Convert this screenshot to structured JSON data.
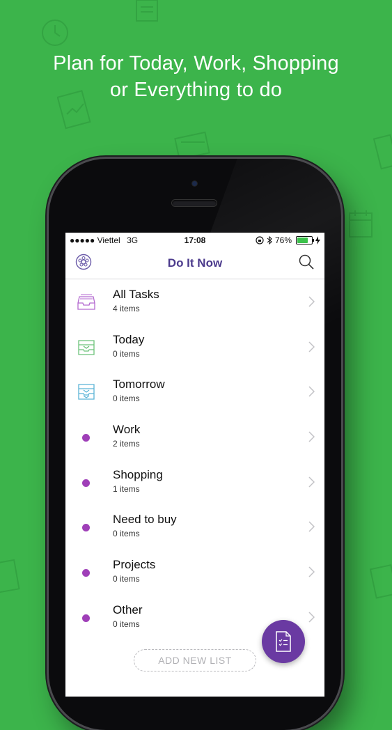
{
  "headline": {
    "line1": "Plan for Today, Work, Shopping",
    "line2": "or Everything to do"
  },
  "statusbar": {
    "carrier": "●●●●● Viettel",
    "network": "3G",
    "time": "17:08",
    "battery_pct": "76%",
    "battery_level": 0.76
  },
  "navbar": {
    "title": "Do It Now",
    "left_icon": "wheel-icon",
    "right_icon": "search-icon"
  },
  "lists": [
    {
      "name": "All Tasks",
      "count": "4 items",
      "icon": "inbox-tray-icon",
      "color": "#b46ad0"
    },
    {
      "name": "Today",
      "count": "0 items",
      "icon": "today-tray-icon",
      "color": "#6cc27a"
    },
    {
      "name": "Tomorrow",
      "count": "0 items",
      "icon": "tomorrow-tray-icon",
      "color": "#5ab3d6"
    },
    {
      "name": "Work",
      "count": "2 items",
      "icon": "dot",
      "color": "#9f3fb8"
    },
    {
      "name": "Shopping",
      "count": "1 items",
      "icon": "dot",
      "color": "#9f3fb8"
    },
    {
      "name": "Need to buy",
      "count": "0 items",
      "icon": "dot",
      "color": "#9f3fb8"
    },
    {
      "name": "Projects",
      "count": "0 items",
      "icon": "dot",
      "color": "#9f3fb8"
    },
    {
      "name": "Other",
      "count": "0 items",
      "icon": "dot",
      "color": "#9f3fb8"
    }
  ],
  "add_list_label": "ADD NEW LIST",
  "fab_icon": "new-task-icon",
  "colors": {
    "background": "#3cb44b",
    "accent": "#4b3a8c",
    "fab": "#6a3aa2"
  }
}
